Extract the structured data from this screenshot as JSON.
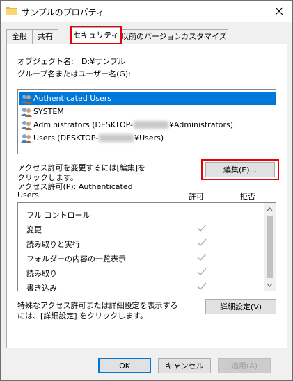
{
  "window": {
    "title": "サンプルのプロパティ"
  },
  "tabs": [
    {
      "label": "全般"
    },
    {
      "label": "共有"
    },
    {
      "label": "セキュリティ"
    },
    {
      "label": "以前のバージョン"
    },
    {
      "label": "カスタマイズ"
    }
  ],
  "security": {
    "object_label": "オブジェクト名:",
    "object_value": "D:¥サンプル",
    "group_label": "グループ名またはユーザー名(G):",
    "users": [
      {
        "prefix": "Authenticated Users",
        "suffix": ""
      },
      {
        "prefix": "SYSTEM",
        "suffix": ""
      },
      {
        "prefix": "Administrators (DESKTOP-",
        "suffix": "¥Administrators)"
      },
      {
        "prefix": "Users (DESKTOP-",
        "suffix": "¥Users)"
      }
    ],
    "change_text_1": "アクセス許可を変更するには[編集]を",
    "change_text_2": "クリックします。",
    "edit_button": "編集(E)...",
    "perm_for_1": "アクセス許可(P): Authenticated",
    "perm_for_2": "Users",
    "col_allow": "許可",
    "col_deny": "拒否",
    "permissions": [
      {
        "name": "フル コントロール",
        "allow": false
      },
      {
        "name": "変更",
        "allow": true
      },
      {
        "name": "読み取りと実行",
        "allow": true
      },
      {
        "name": "フォルダーの内容の一覧表示",
        "allow": true
      },
      {
        "name": "読み取り",
        "allow": true
      },
      {
        "name": "書き込み",
        "allow": true
      }
    ],
    "special_text_1": "特殊なアクセス許可または詳細設定を表示する",
    "special_text_2": "には、[詳細設定] をクリックします。",
    "advanced_button": "詳細設定(V)"
  },
  "footer": {
    "ok": "OK",
    "cancel": "キャンセル",
    "apply": "適用(A)"
  },
  "colors": {
    "highlight": "#0078d7",
    "annotation_red": "#e8000b"
  }
}
